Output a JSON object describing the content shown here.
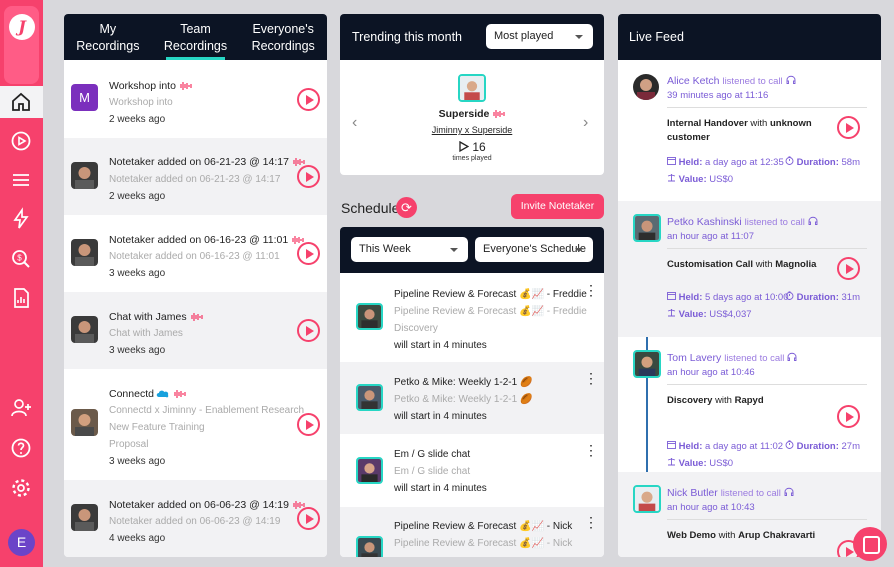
{
  "sidebar": {
    "logo": "J",
    "avatar_initial": "E",
    "items": [
      "home-icon",
      "play-circle-icon",
      "menu-icon",
      "bolt-icon",
      "search-dollar-icon",
      "report-icon",
      "add-user-icon",
      "help-icon",
      "gear-icon"
    ]
  },
  "recordings": {
    "tabs": [
      {
        "label": "My\nRecordings",
        "active": false
      },
      {
        "label": "Team\nRecordings",
        "active": true
      },
      {
        "label": "Everyone's\nRecordings",
        "active": false
      }
    ],
    "items": [
      {
        "title": "Workshop into",
        "sub": [
          "Workshop into"
        ],
        "age": "2 weeks ago",
        "initial": "M"
      },
      {
        "title": "Notetaker added on 06-21-23 @ 14:17",
        "sub": [
          "Notetaker added on 06-21-23 @ 14:17"
        ],
        "age": "2 weeks ago"
      },
      {
        "title": "Notetaker added on 06-16-23 @ 11:01",
        "sub": [
          "Notetaker added on 06-16-23 @ 11:01"
        ],
        "age": "3 weeks ago"
      },
      {
        "title": "Chat with James",
        "sub": [
          "Chat with James"
        ],
        "age": "3 weeks ago"
      },
      {
        "title": "Connectd",
        "sub": [
          "Connectd x Jiminny - Enablement Research",
          "New Feature Training",
          "Proposal"
        ],
        "age": "3 weeks ago"
      },
      {
        "title": "Notetaker added on 06-06-23 @ 14:19",
        "sub": [
          "Notetaker added on 06-06-23 @ 14:19"
        ],
        "age": "4 weeks ago"
      }
    ]
  },
  "trending": {
    "title": "Trending this month",
    "filter": "Most played",
    "name": "Superside",
    "subtitle": "Jiminny x Superside",
    "count": "16",
    "count_label": "times played"
  },
  "schedule": {
    "title": "Schedule",
    "invite_label": "Invite Notetaker",
    "period": "This Week",
    "scope": "Everyone's Schedule",
    "items": [
      {
        "title": "Pipeline Review & Forecast 💰📈 - Freddie",
        "sub": [
          "Pipeline Review & Forecast 💰📈 - Freddie",
          "Discovery"
        ],
        "start": "will start in 4 minutes"
      },
      {
        "title": "Petko & Mike: Weekly 1-2-1 🏉",
        "sub": [
          "Petko & Mike: Weekly 1-2-1 🏉"
        ],
        "start": "will start in 4 minutes"
      },
      {
        "title": "Em / G slide chat",
        "sub": [
          "Em / G slide chat"
        ],
        "start": "will start in 4 minutes"
      },
      {
        "title": "Pipeline Review & Forecast 💰📈 - Nick",
        "sub": [
          "Pipeline Review & Forecast 💰📈 - Nick"
        ],
        "start": ""
      }
    ]
  },
  "feed": {
    "title": "Live Feed",
    "listened": "listened to call",
    "held_label": "Held:",
    "duration_label": "Duration:",
    "value_label": "Value:",
    "items": [
      {
        "name": "Alice Ketch",
        "time": "39 minutes ago at 11:16",
        "call": "Internal Handover",
        "with_word": "with",
        "company": "unknown customer",
        "held": "a day ago at 12:35",
        "duration": "58m",
        "value": "US$0"
      },
      {
        "name": "Petko Kashinski",
        "time": "an hour ago at 11:07",
        "call": "Customisation Call",
        "with_word": "with",
        "company": "Magnolia",
        "held": "5 days ago at 10:00",
        "duration": "31m",
        "value": "US$4,037"
      },
      {
        "name": "Tom Lavery",
        "time": "an hour ago at 10:46",
        "call": "Discovery",
        "with_word": "with",
        "company": "Rapyd",
        "held": "a day ago at 11:02",
        "duration": "27m",
        "value": "US$0"
      },
      {
        "name": "Nick Butler",
        "time": "an hour ago at 10:43",
        "call": "Web Demo",
        "with_word": "with",
        "company": "Arup Chakravarti",
        "held": "",
        "duration": "",
        "value": ""
      }
    ]
  },
  "colors": {
    "accent": "#f6416c",
    "teal": "#27d6c4",
    "navy": "#0c1424",
    "purple": "#7b5cd6"
  }
}
